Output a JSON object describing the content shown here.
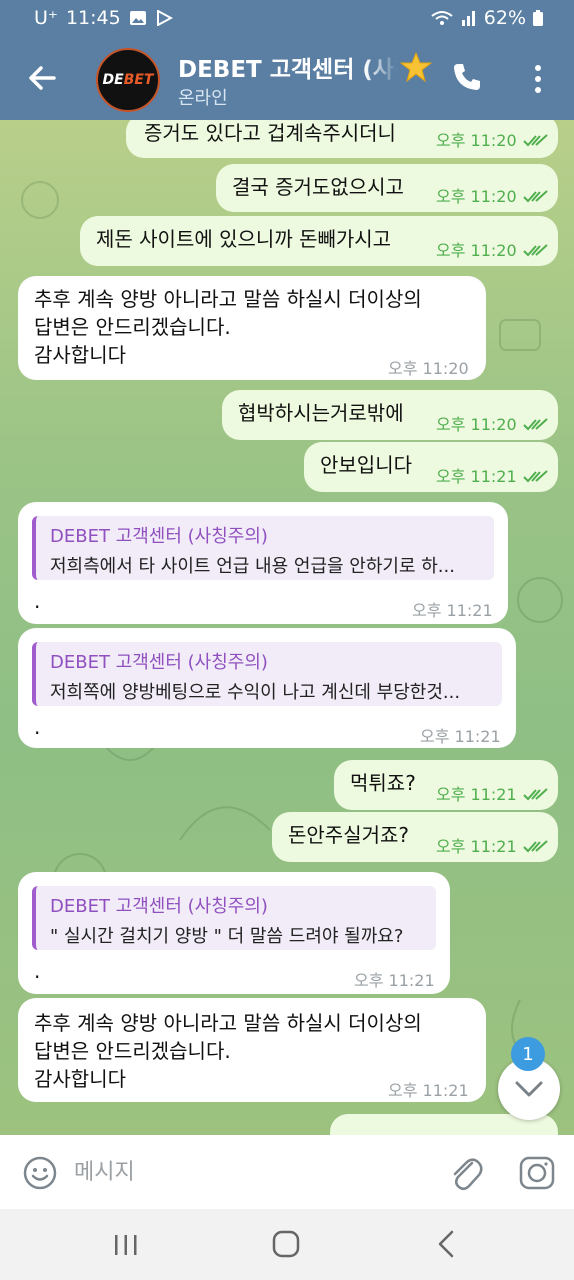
{
  "status_bar": {
    "carrier": "U⁺",
    "time": "11:45",
    "battery": "62%"
  },
  "header": {
    "title": "DEBET 고객센터 (사칭주의)",
    "subtitle": "온라인",
    "avatar_text_1": "DE",
    "avatar_text_2": "BET"
  },
  "messages": [
    {
      "dir": "out",
      "text": "증거도 있다고 겁계속주시더니",
      "time": "오후 11:20"
    },
    {
      "dir": "out",
      "text": "결국 증거도없으시고",
      "time": "오후 11:20"
    },
    {
      "dir": "out",
      "text": "제돈 사이트에 있으니까 돈빼가시고",
      "time": "오후 11:20"
    },
    {
      "dir": "in",
      "lines": [
        "추후 계속 양방 아니라고 말씀 하실시 더이상의",
        "답변은 안드리겠습니다.",
        "감사합니다"
      ],
      "time": "오후 11:20"
    },
    {
      "dir": "out",
      "text": "협박하시는거로밖에",
      "time": "오후 11:20"
    },
    {
      "dir": "out",
      "text": "안보입니다",
      "time": "오후 11:21"
    },
    {
      "dir": "in",
      "quote_name": "DEBET 고객센터 (사칭주의)",
      "quote_text": "저희측에서 타 사이트 언급 내용 언급을 안하기로 하...",
      "text": ".",
      "time": "오후 11:21"
    },
    {
      "dir": "in",
      "quote_name": "DEBET 고객센터 (사칭주의)",
      "quote_text": "저희쪽에 양방베팅으로 수익이 나고 계신데 부당한것...",
      "text": ".",
      "time": "오후 11:21"
    },
    {
      "dir": "out",
      "text": "먹튀죠?",
      "time": "오후 11:21"
    },
    {
      "dir": "out",
      "text": "돈안주실거죠?",
      "time": "오후 11:21"
    },
    {
      "dir": "in",
      "quote_name": "DEBET 고객센터 (사칭주의)",
      "quote_text": "\" 실시간 걸치기 양방 \" 더 말씀 드려야 될까요?",
      "text": ".",
      "time": "오후 11:21"
    },
    {
      "dir": "in",
      "lines": [
        "추후 계속 양방 아니라고 말씀 하실시 더이상의",
        "답변은 안드리겠습니다.",
        "감사합니다"
      ],
      "time": "오후 11:21"
    }
  ],
  "scroll_badge": "1",
  "input": {
    "placeholder": "메시지"
  },
  "colors": {
    "header": "#5a7fa3",
    "outgoing_bubble": "#eefadf",
    "incoming_bubble": "#ffffff",
    "read_ticks": "#4fae4e",
    "quote_accent": "#a05ccd",
    "badge": "#3d9be0"
  },
  "icons": [
    "back-arrow-icon",
    "star-icon",
    "phone-icon",
    "more-vert-icon",
    "double-check-icon",
    "chevron-down-icon",
    "emoji-icon",
    "paperclip-icon",
    "camera-icon",
    "recent-apps-icon",
    "home-icon",
    "nav-back-icon"
  ]
}
